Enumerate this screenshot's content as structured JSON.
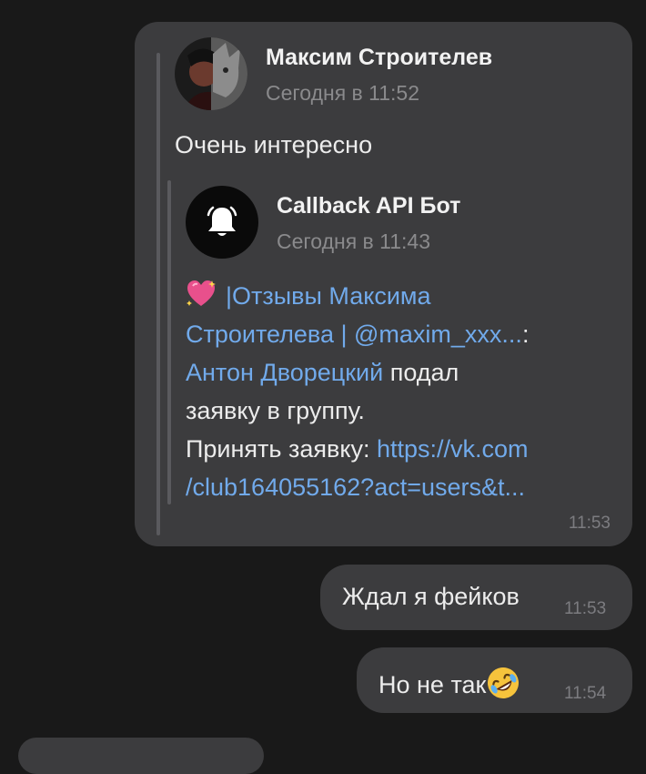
{
  "chat": {
    "message1": {
      "author": "Максим Строителев",
      "time": "Сегодня в 11:52",
      "text": "Очень интересно",
      "forwarded": {
        "author": "Callback API Бот",
        "time": "Сегодня в 11:43",
        "line1_link": "|Отзывы Максима",
        "line2_link": "Строителева | @maxim_xxx...",
        "line2_tail": ":",
        "line3_link": "Антон Дворецкий",
        "line3_tail": " подал",
        "line4": "заявку в группу.",
        "line5_text": "Принять заявку: ",
        "line5_link": "https://vk.com",
        "line6_link": "/club164055162?act=users&t..."
      },
      "stamp": "11:53"
    },
    "message2": {
      "text": "Ждал я фейков",
      "stamp": "11:53"
    },
    "message3": {
      "text": "Но не так",
      "stamp": "11:54"
    }
  },
  "colors": {
    "background": "#191919",
    "bubble": "#3c3c3e",
    "link": "#71aaeb"
  },
  "icons": {
    "bot_avatar": "bell-icon",
    "heart": "sparkling-heart-icon",
    "emoji": "rolling-laughing-icon"
  }
}
